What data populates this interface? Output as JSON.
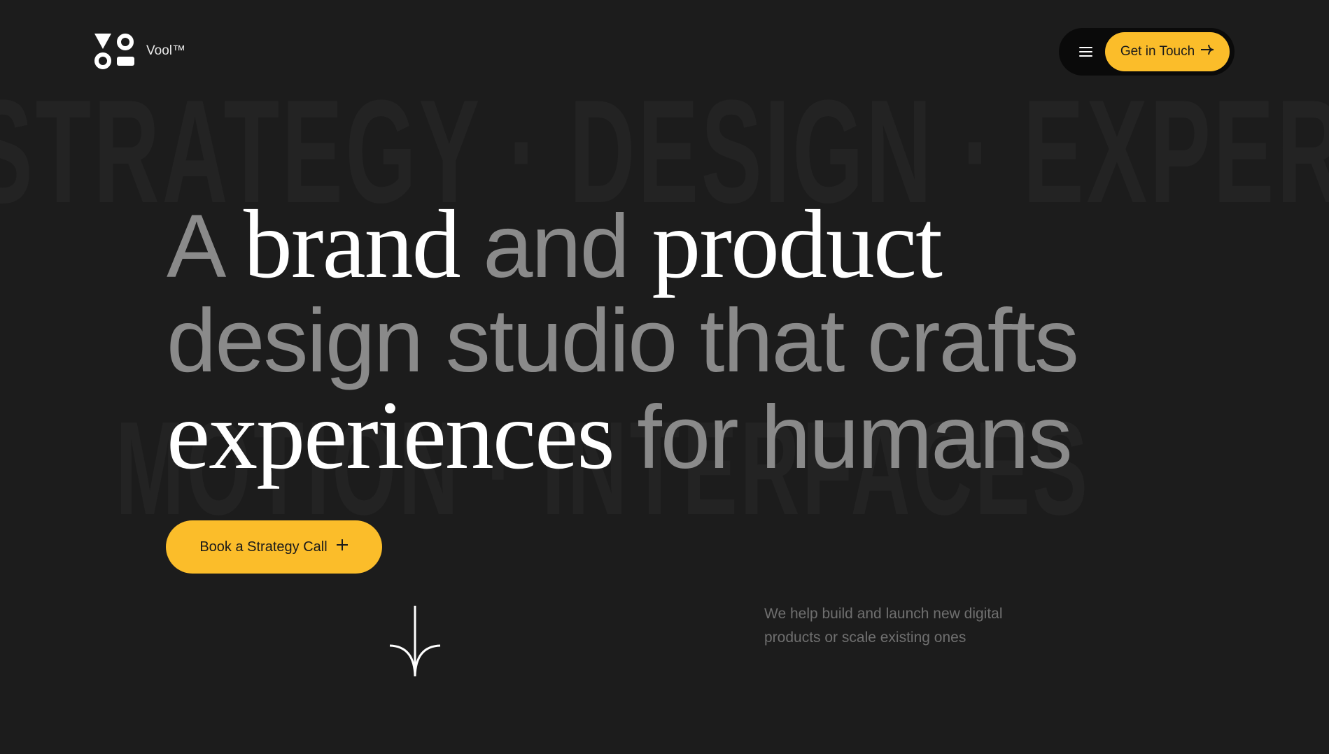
{
  "background": {
    "row1": "STRATEGY · DESIGN · EXPERIENCE",
    "row2": "MOTION · INTERFACES"
  },
  "header": {
    "brand_name": "Vool™",
    "logo_icon": "vool-logo-icon",
    "menu_icon": "hamburger-menu-icon",
    "get_in_touch_label": "Get in Touch",
    "get_in_touch_icon": "arrow-right-icon"
  },
  "hero": {
    "line1": {
      "w1": "A",
      "w2": "brand",
      "w3": "and",
      "w4": "product"
    },
    "line2": "design studio that crafts",
    "line3": {
      "w1": "experiences",
      "w2": "for humans"
    },
    "cta_label": "Book a Strategy Call",
    "cta_icon": "plus-icon",
    "scroll_icon": "scroll-down-arrow-icon",
    "subtext": "We help build and launch new digital products or scale existing ones"
  },
  "colors": {
    "background": "#1c1c1c",
    "accent": "#fbbd2a",
    "muted_text": "#8a8a8a",
    "pill_bg": "#0a0a0a"
  }
}
